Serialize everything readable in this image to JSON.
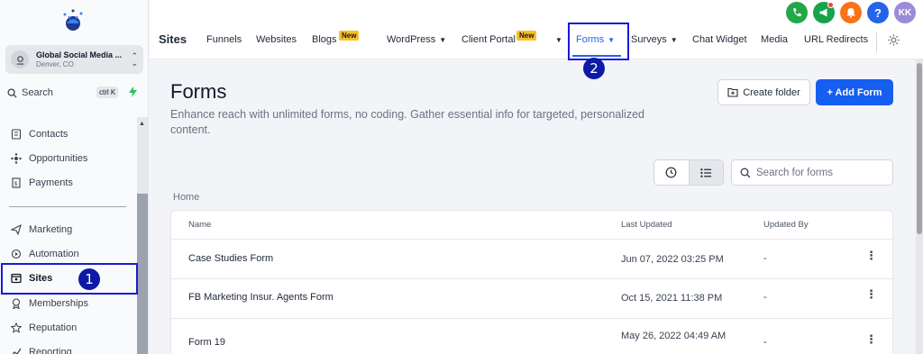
{
  "sidebar": {
    "account": {
      "name": "Global Social Media ...",
      "location": "Denver, CO"
    },
    "search": {
      "label": "Search",
      "shortcut": "ctrl K"
    },
    "items": [
      {
        "label": "Contacts",
        "icon": "contacts-icon"
      },
      {
        "label": "Opportunities",
        "icon": "opportunities-icon"
      },
      {
        "label": "Payments",
        "icon": "payments-icon"
      },
      {
        "label": "Marketing",
        "icon": "marketing-icon"
      },
      {
        "label": "Automation",
        "icon": "automation-icon"
      },
      {
        "label": "Sites",
        "icon": "sites-icon"
      },
      {
        "label": "Memberships",
        "icon": "memberships-icon"
      },
      {
        "label": "Reputation",
        "icon": "reputation-icon"
      },
      {
        "label": "Reporting",
        "icon": "reporting-icon"
      }
    ]
  },
  "annotations": {
    "marker1": "1",
    "marker2": "2",
    "box_color": "#1a1ad8"
  },
  "topbar": {
    "avatar_initials": "KK",
    "section_title": "Sites",
    "tabs": {
      "funnels": "Funnels",
      "websites": "Websites",
      "blogs": "Blogs",
      "wordpress": "WordPress",
      "client_portal": "Client Portal",
      "forms": "Forms",
      "surveys": "Surveys",
      "chat_widget": "Chat Widget",
      "media": "Media",
      "url_redirects": "URL Redirects"
    },
    "new_badge": "New"
  },
  "main": {
    "title": "Forms",
    "subtitle": "Enhance reach with unlimited forms, no coding. Gather essential info for targeted, personalized content.",
    "create_folder": "Create folder",
    "add_form": "+ Add Form",
    "search_placeholder": "Search for forms",
    "breadcrumb": "Home",
    "table": {
      "headers": {
        "name": "Name",
        "last_updated": "Last Updated",
        "updated_by": "Updated By"
      },
      "rows": [
        {
          "name": "Case Studies Form",
          "last_updated": "Jun 07, 2022 03:25 PM",
          "updated_by": "-"
        },
        {
          "name": "FB Marketing Insur. Agents Form",
          "last_updated": "Oct 15, 2021 11:38 PM",
          "updated_by": "-"
        },
        {
          "name": "Form 19",
          "last_updated": "May 26, 2022 04:49 AM",
          "updated_by": "-"
        }
      ]
    }
  },
  "colors": {
    "accent": "#155eef",
    "active_tab": "#2563eb",
    "badge": "#fbbf24",
    "phone_icon": "#22a847",
    "megaphone_icon": "#16a34a",
    "bell_icon": "#f97316",
    "help_icon": "#2563eb",
    "avatar": "#9b8bd9"
  }
}
